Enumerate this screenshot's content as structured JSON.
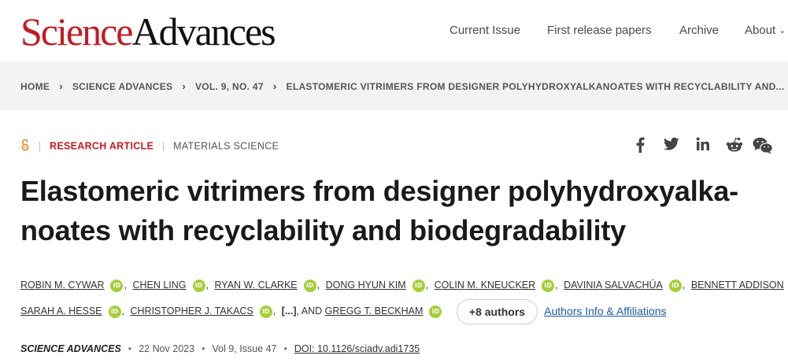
{
  "header": {
    "logo_part1": "Science",
    "logo_part2": "Advances",
    "nav": [
      "Current Issue",
      "First release papers",
      "Archive",
      "About"
    ]
  },
  "breadcrumb": [
    "HOME",
    "SCIENCE ADVANCES",
    "VOL. 9, NO. 47",
    "ELASTOMERIC VITRIMERS FROM DESIGNER POLYHYDROXYALKANOATES WITH RECYCLABILITY AND..."
  ],
  "meta": {
    "article_type": "RESEARCH ARTICLE",
    "subject": "MATERIALS SCIENCE"
  },
  "share_icons": [
    "facebook-icon",
    "twitter-icon",
    "linkedin-icon",
    "reddit-icon",
    "wechat-icon"
  ],
  "title": "Elastomeric vitrimers from designer polyhydroxyalka-noates with recyclability and biodegradability",
  "title_line1": "Elastomeric vitrimers from designer polyhydroxyalka-",
  "title_line2": "noates with recyclability and biodegradability",
  "authors": [
    "Robin M. Cywar",
    "Chen Ling",
    "Ryan W. Clarke",
    "Dong Hyun Kim",
    "Colin M. Kneucker",
    "Davinia Salvachúa",
    "Bennett Addison",
    "Sarah A. Hesse",
    "Christopher J. Takacs",
    "Gregg T. Beckham"
  ],
  "orcid_label": "iD",
  "ellipsis": "[...]",
  "and_label": ", AND",
  "more_authors": "+8 authors",
  "affiliations_link": "Authors Info & Affiliations",
  "pub": {
    "journal": "SCIENCE ADVANCES",
    "date": "22 Nov 2023",
    "issue": "Vol 9, Issue 47",
    "doi": "DOI: 10.1126/sciadv.adi1735"
  },
  "colors": {
    "brand_red": "#c41a22",
    "orcid_green": "#a6ce39",
    "link_blue": "#1c5aa6",
    "oa_orange": "#f08a24"
  }
}
